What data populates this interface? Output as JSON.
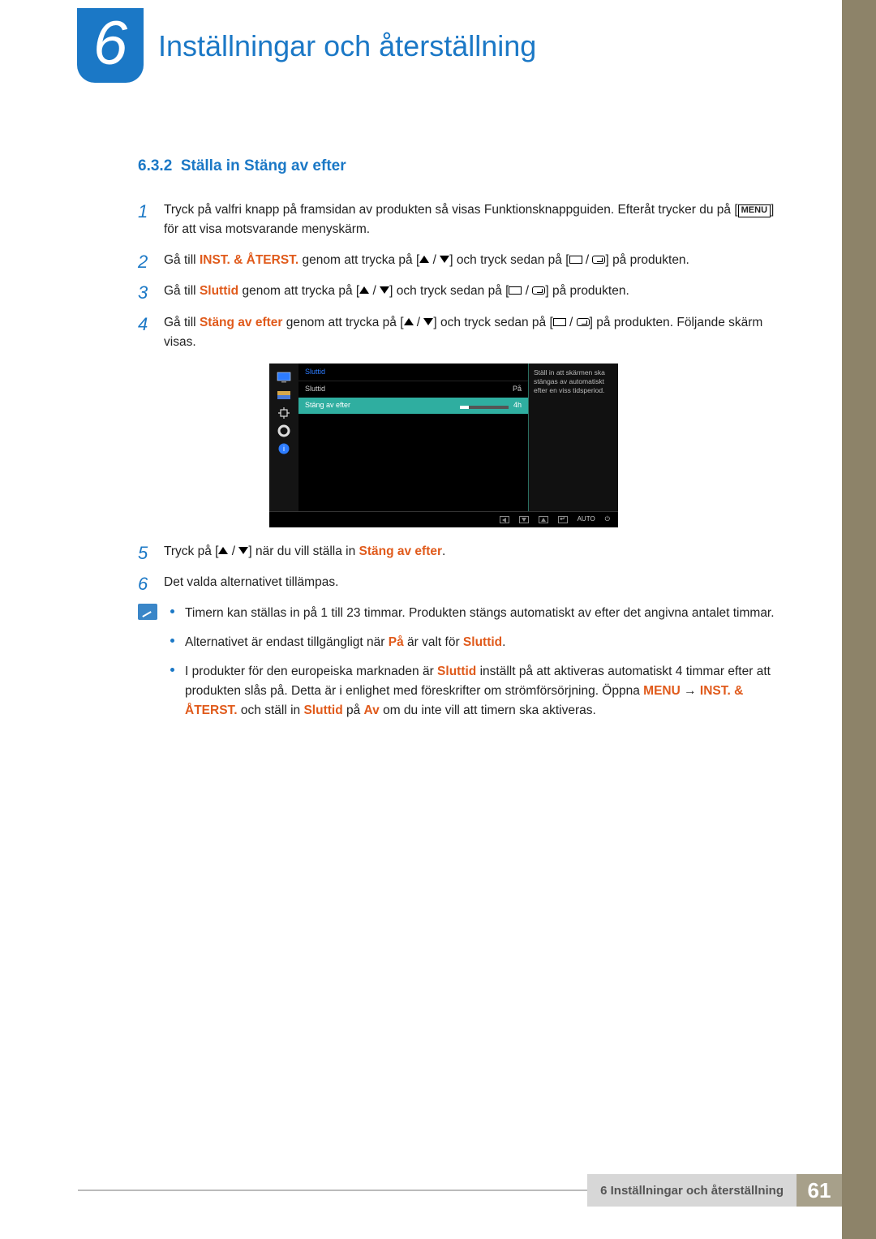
{
  "chapter": {
    "badge_number": "6",
    "title": "Inställningar och återställning"
  },
  "section": {
    "number": "6.3.2",
    "title": "Ställa in Stäng av efter"
  },
  "menu_label": "MENU",
  "steps": {
    "s1a": "Tryck på valfri knapp på framsidan av produkten så visas Funktionsknappguiden. Efteråt trycker du på [",
    "s1b": "] för att visa motsvarande menyskärm.",
    "s2a": "Gå till ",
    "s2hl": "INST. & ÅTERST.",
    "s2b": " genom att trycka på [",
    "s2c": "] och tryck sedan på [",
    "s2d": "] på produkten.",
    "s3a": "Gå till ",
    "s3hl": "Sluttid",
    "s3b": " genom att trycka på [",
    "s3c": "] och tryck sedan på [",
    "s3d": "] på produkten.",
    "s4a": "Gå till ",
    "s4hl": "Stäng av efter",
    "s4b": " genom att trycka på [",
    "s4c": "] och tryck sedan på [",
    "s4d": "] på produkten. Följande skärm visas.",
    "s5a": "Tryck på [",
    "s5b": "] när du vill ställa in ",
    "s5hl": "Stäng av efter",
    "s5c": ".",
    "s6": "Det valda alternativet tillämpas."
  },
  "osd": {
    "header": "Sluttid",
    "row1_label": "Sluttid",
    "row1_value": "På",
    "row2_label": "Stäng av efter",
    "row2_value": "4h",
    "help_text": "Ställ in att skärmen ska stängas av automatiskt efter en viss tidsperiod.",
    "footer_auto": "AUTO"
  },
  "notes": {
    "n1": "Timern kan ställas in på 1 till 23 timmar. Produkten stängs automatiskt av efter det angivna antalet timmar.",
    "n2a": "Alternativet är endast tillgängligt när ",
    "n2hl1": "På",
    "n2b": " är valt för ",
    "n2hl2": "Sluttid",
    "n2c": ".",
    "n3a": "I produkter för den europeiska marknaden är ",
    "n3hl1": "Sluttid",
    "n3b": " inställt på att aktiveras automatiskt 4 timmar efter att produkten slås på. Detta är i enlighet med föreskrifter om strömförsörjning. Öppna ",
    "n3hl2": "MENU",
    "n3arrow": " → ",
    "n3hl3": "INST. & ÅTERST.",
    "n3c": " och ställ in ",
    "n3hl4": "Sluttid",
    "n3d": " på ",
    "n3hl5": "Av",
    "n3e": " om du inte vill att timern ska aktiveras."
  },
  "footer": {
    "label": "6 Inställningar och återställning",
    "page": "61"
  }
}
